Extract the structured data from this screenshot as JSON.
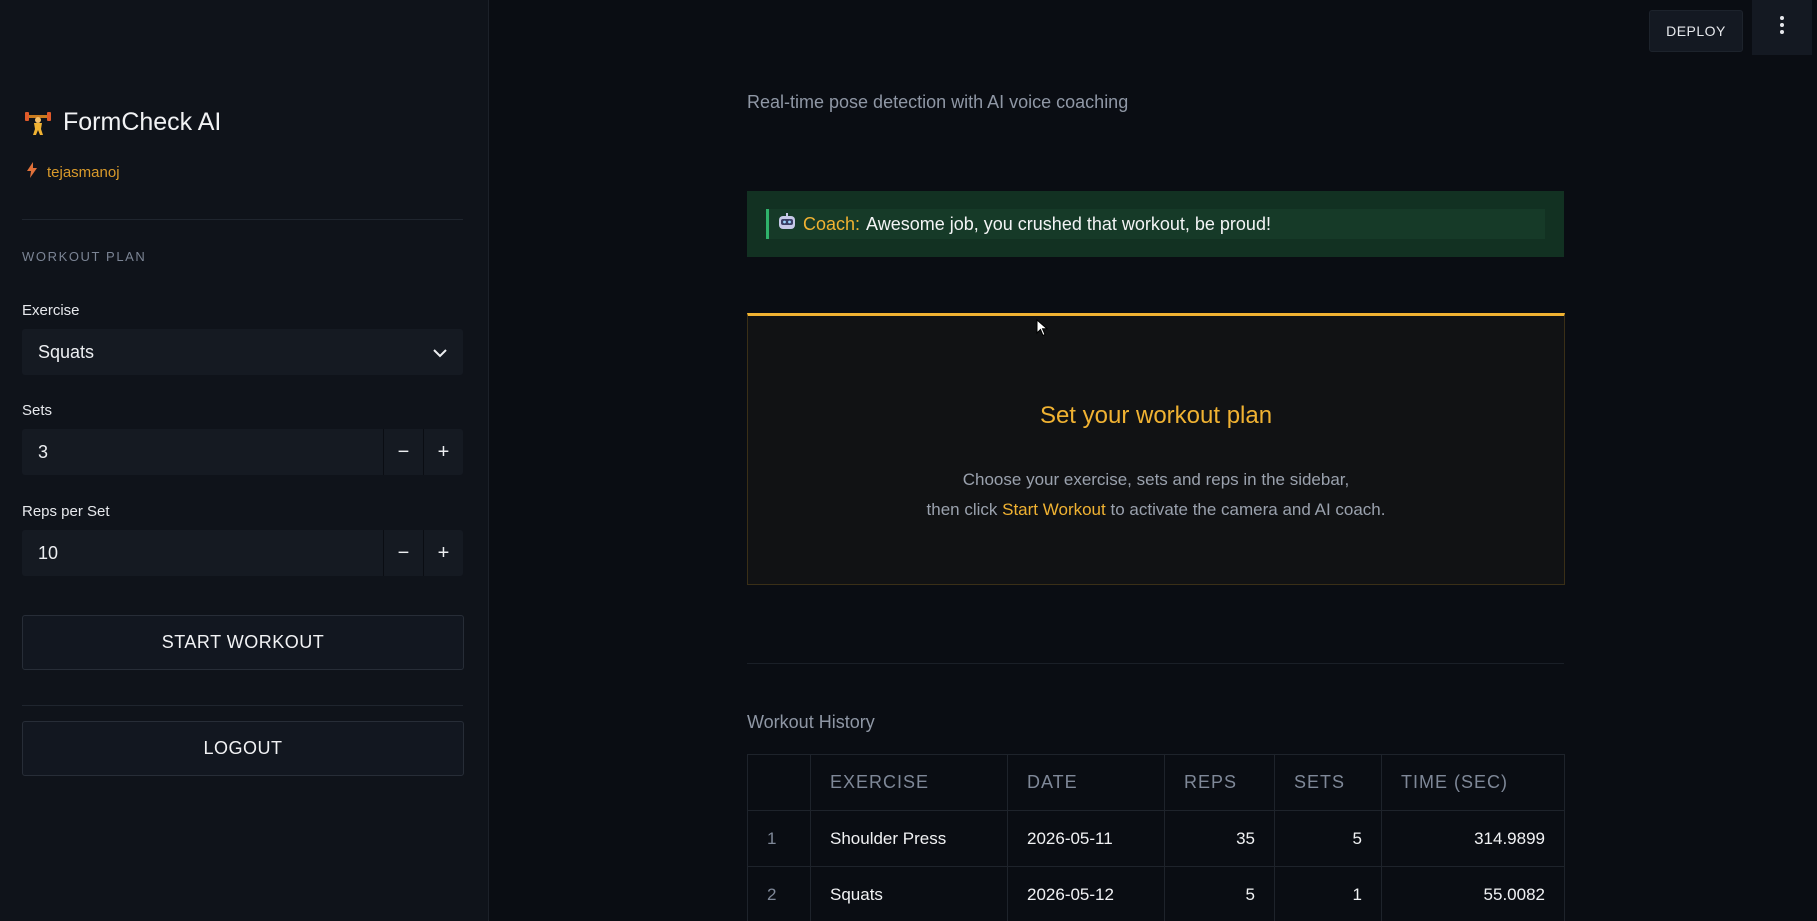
{
  "brand": {
    "title": "FormCheck AI",
    "icon": "weightlifter-icon"
  },
  "user": {
    "name": "tejasmanoj",
    "icon": "lightning-icon"
  },
  "sidebar": {
    "section_label": "WORKOUT PLAN",
    "exercise": {
      "label": "Exercise",
      "value": "Squats"
    },
    "sets": {
      "label": "Sets",
      "value": "3"
    },
    "reps": {
      "label": "Reps per Set",
      "value": "10"
    },
    "start_label": "START WORKOUT",
    "logout_label": "LOGOUT"
  },
  "topbar": {
    "deploy_label": "DEPLOY"
  },
  "main": {
    "subtitle": "Real-time pose detection with AI voice coaching",
    "coach": {
      "label": "Coach:",
      "message": "Awesome job, you crushed that workout, be proud!"
    },
    "plan": {
      "title": "Set your workout plan",
      "line1": "Choose your exercise, sets and reps in the sidebar,",
      "line2_pre": "then click",
      "line2_highlight": "Start Workout",
      "line2_post": "to activate the camera and AI coach."
    },
    "history": {
      "title": "Workout History",
      "columns": [
        "",
        "EXERCISE",
        "DATE",
        "REPS",
        "SETS",
        "TIME (SEC)"
      ],
      "rows": [
        {
          "idx": "1",
          "exercise": "Shoulder Press",
          "date": "2026-05-11",
          "reps": "35",
          "sets": "5",
          "time": "314.9899"
        },
        {
          "idx": "2",
          "exercise": "Squats",
          "date": "2026-05-12",
          "reps": "5",
          "sets": "1",
          "time": "55.0082"
        }
      ]
    }
  },
  "colors": {
    "accent": "#f0b232",
    "coach_bg": "#123122",
    "coach_bar": "#2fb26b"
  }
}
